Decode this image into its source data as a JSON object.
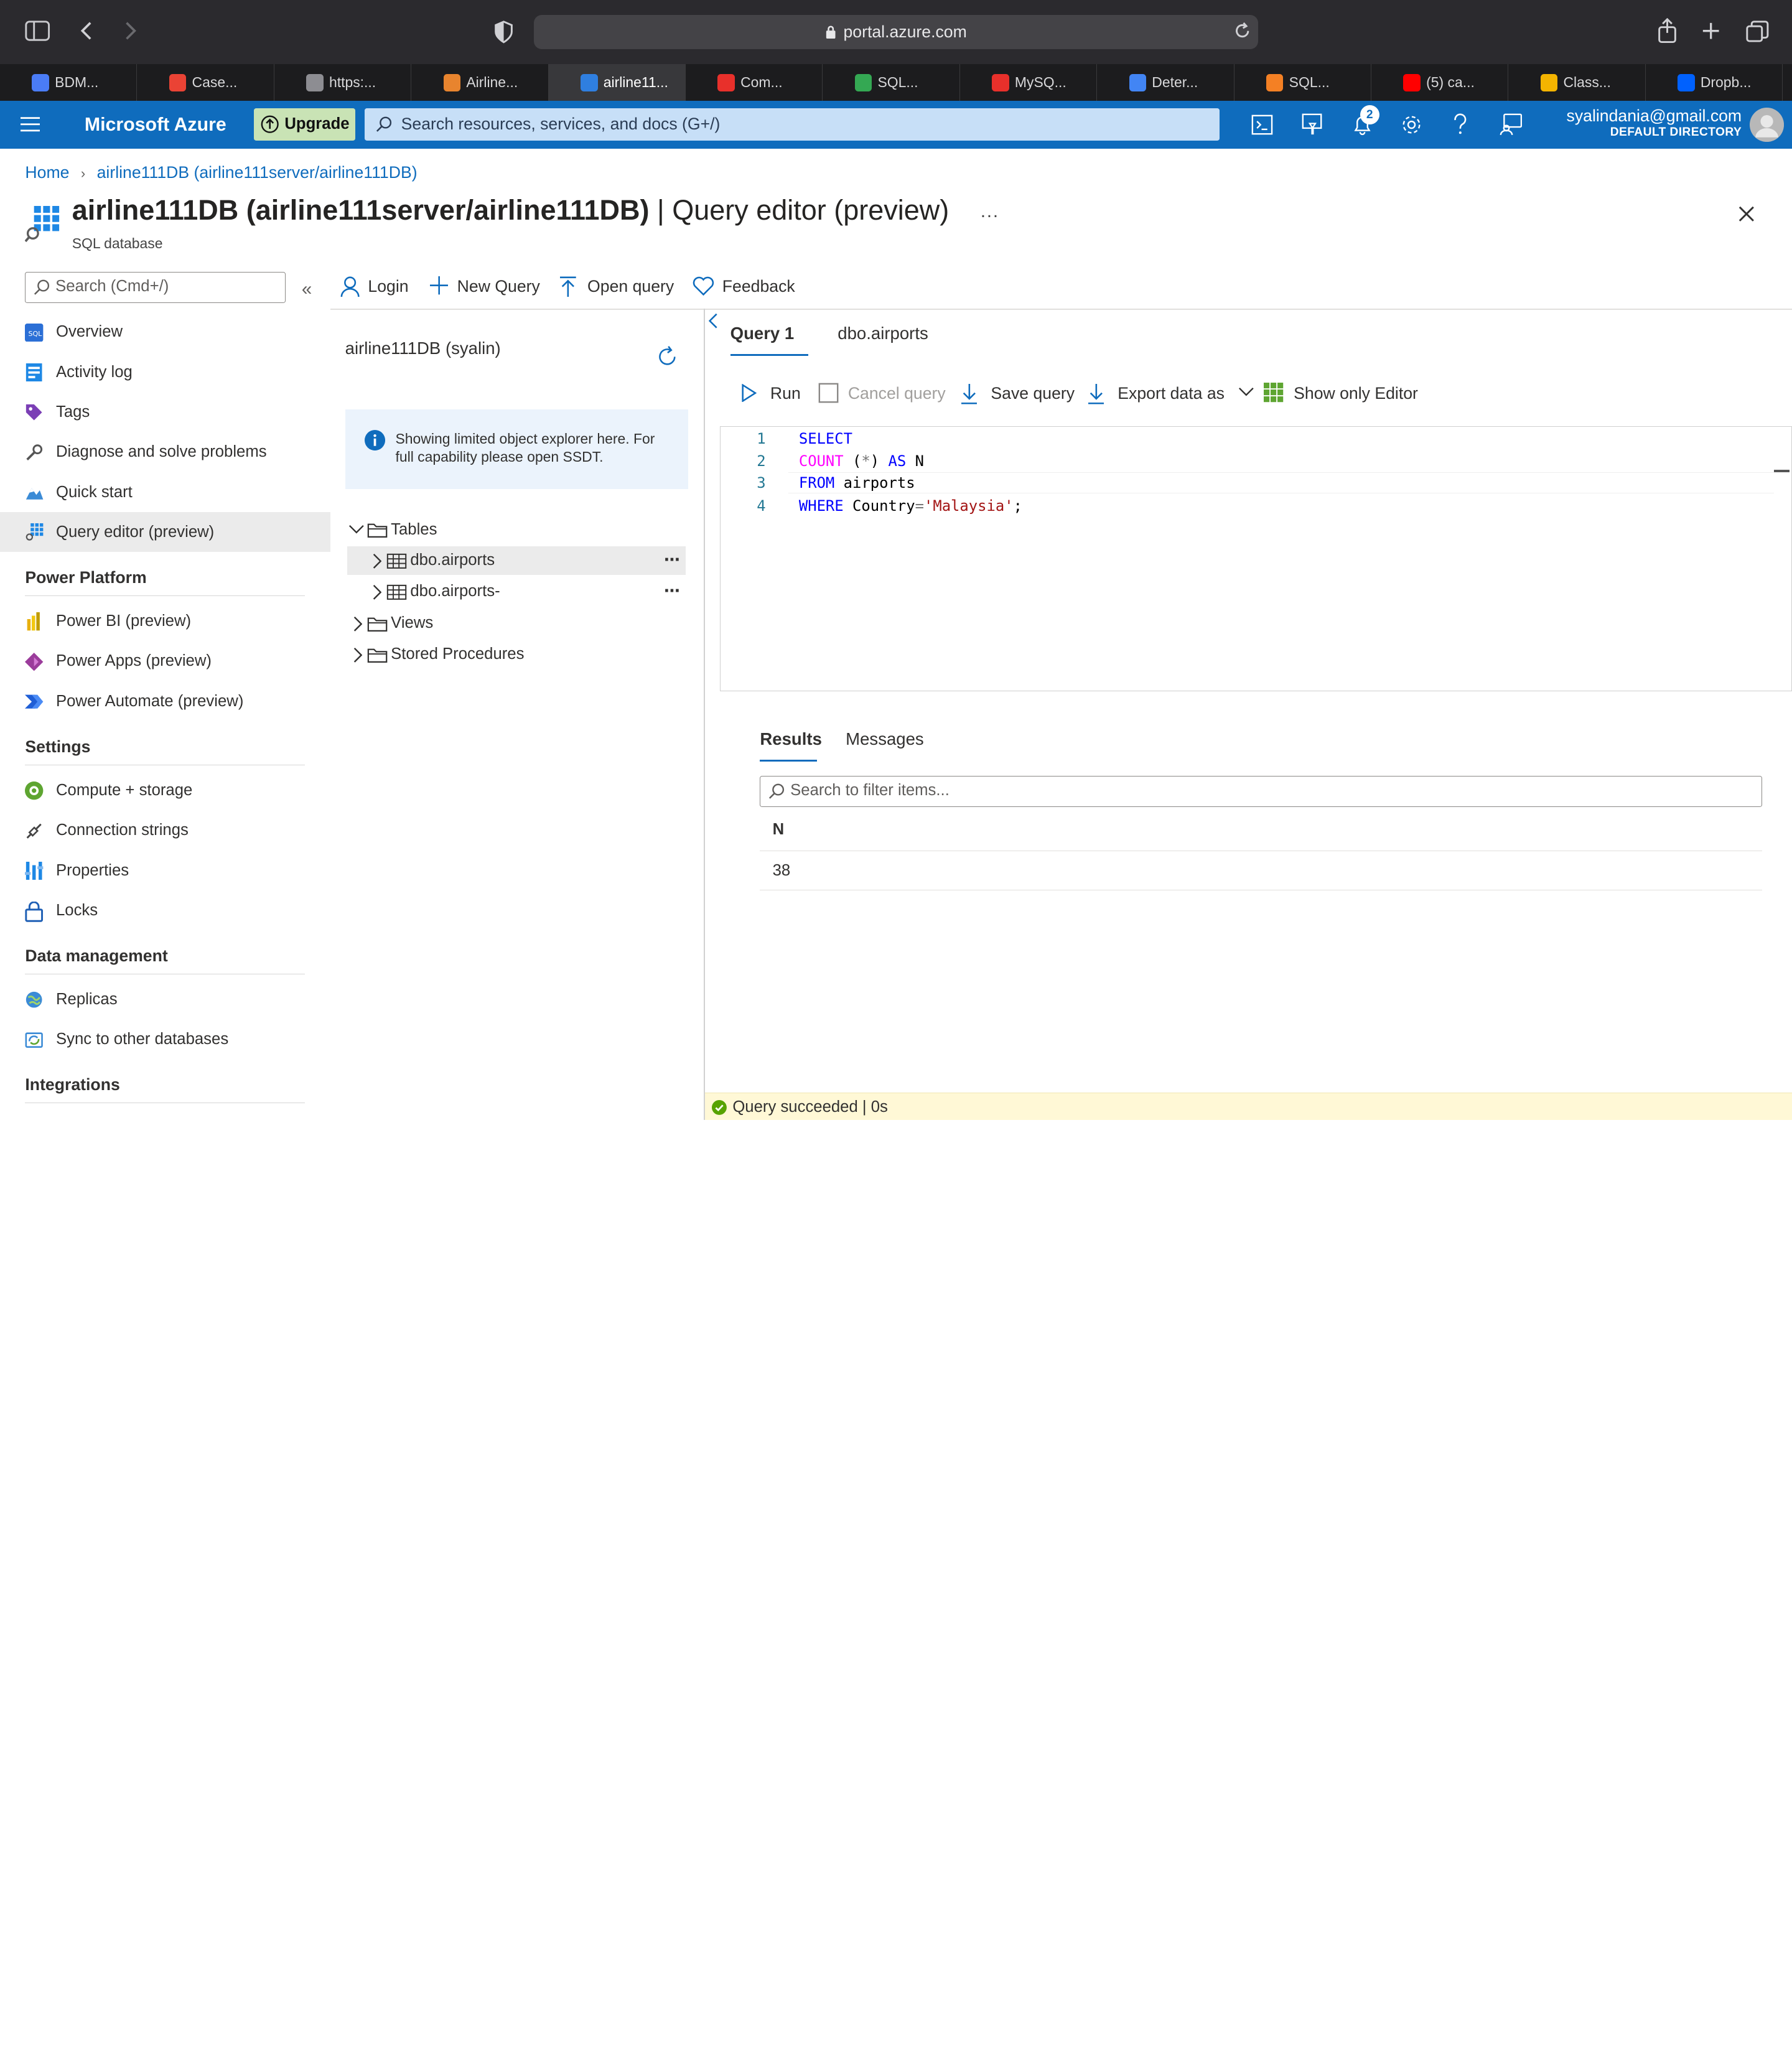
{
  "browser": {
    "url": "portal.azure.com",
    "tabs": [
      {
        "label": "BDM...",
        "color": "#4a7cf6"
      },
      {
        "label": "Case...",
        "color": "#ea4335"
      },
      {
        "label": "https:...",
        "color": "#8d8d92"
      },
      {
        "label": "Airline...",
        "color": "#e8842e"
      },
      {
        "label": "airline11...",
        "color": "#2f7fe0",
        "active": true
      },
      {
        "label": "Com...",
        "color": "#e8302b"
      },
      {
        "label": "SQL...",
        "color": "#34a853"
      },
      {
        "label": "MySQ...",
        "color": "#e8302b"
      },
      {
        "label": "Deter...",
        "color": "#4285f4"
      },
      {
        "label": "SQL...",
        "color": "#f48024"
      },
      {
        "label": "(5) ca...",
        "color": "#ff0000"
      },
      {
        "label": "Class...",
        "color": "#f4b400"
      },
      {
        "label": "Dropb...",
        "color": "#0061fe"
      }
    ]
  },
  "header": {
    "brand": "Microsoft Azure",
    "upgrade": "Upgrade",
    "search_placeholder": "Search resources, services, and docs (G+/)",
    "notification_count": "2",
    "email": "syalindania@gmail.com",
    "directory": "DEFAULT DIRECTORY"
  },
  "breadcrumb": {
    "home": "Home",
    "db": "airline111DB (airline111server/airline111DB)"
  },
  "page": {
    "title_bold": "airline111DB (airline111server/airline111DB)",
    "title_light": " | Query editor (preview)",
    "more": "...",
    "subtitle": "SQL database"
  },
  "menu": {
    "search_placeholder": "Search (Cmd+/)",
    "items": [
      {
        "label": "Overview"
      },
      {
        "label": "Activity log"
      },
      {
        "label": "Tags"
      },
      {
        "label": "Diagnose and solve problems"
      },
      {
        "label": "Quick start"
      },
      {
        "label": "Query editor (preview)"
      }
    ],
    "sections": [
      {
        "title": "Power Platform",
        "items": [
          {
            "label": "Power BI (preview)"
          },
          {
            "label": "Power Apps (preview)"
          },
          {
            "label": "Power Automate (preview)"
          }
        ]
      },
      {
        "title": "Settings",
        "items": [
          {
            "label": "Compute + storage"
          },
          {
            "label": "Connection strings"
          },
          {
            "label": "Properties"
          },
          {
            "label": "Locks"
          }
        ]
      },
      {
        "title": "Data management",
        "items": [
          {
            "label": "Replicas"
          },
          {
            "label": "Sync to other databases"
          }
        ]
      },
      {
        "title": "Integrations",
        "items": []
      }
    ]
  },
  "toolbar": {
    "login": "Login",
    "new_query": "New Query",
    "open_query": "Open query",
    "feedback": "Feedback"
  },
  "explorer": {
    "db_label": "airline111DB (syalin)",
    "info": "Showing limited object explorer here. For full capability please open SSDT.",
    "tables": "Tables",
    "table_items": [
      "dbo.airports",
      "dbo.airports-"
    ],
    "views": "Views",
    "procs": "Stored Procedures"
  },
  "editor": {
    "tabs": [
      "Query 1",
      "dbo.airports"
    ],
    "run": "Run",
    "cancel": "Cancel query",
    "save": "Save query",
    "export": "Export data as",
    "show_editor": "Show only Editor",
    "line_numbers": [
      "1",
      "2",
      "3",
      "4"
    ],
    "code": {
      "l1": "SELECT",
      "l2_fn": "COUNT",
      "l2_mid": " (",
      "l2_star": "*",
      "l2_close": ") ",
      "l2_as": "AS",
      "l2_n": " N",
      "l3_kw": "FROM",
      "l3_rest": " airports",
      "l4_kw": "WHERE",
      "l4_col": " Country",
      "l4_eq": "=",
      "l4_str": "'Malaysia'",
      "l4_end": ";"
    }
  },
  "results": {
    "tabs": [
      "Results",
      "Messages"
    ],
    "search_placeholder": "Search to filter items...",
    "column": "N",
    "value": "38",
    "status": "Query succeeded | 0s"
  }
}
